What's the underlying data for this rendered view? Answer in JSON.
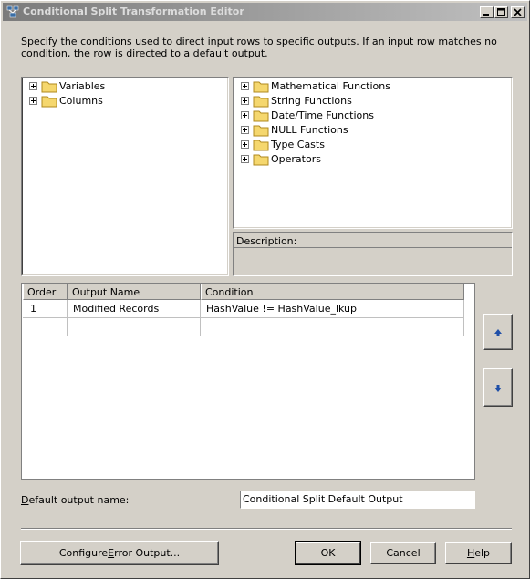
{
  "window": {
    "title": "Conditional Split Transformation Editor"
  },
  "description": "Specify the conditions used to direct input rows to specific outputs. If an input row matches no condition, the row is directed to a default output.",
  "left_tree": [
    {
      "label": "Variables",
      "icon": "folder-icon"
    },
    {
      "label": "Columns",
      "icon": "folder-icon"
    }
  ],
  "right_tree": [
    {
      "label": "Mathematical Functions",
      "icon": "folder-icon"
    },
    {
      "label": "String Functions",
      "icon": "folder-icon"
    },
    {
      "label": "Date/Time Functions",
      "icon": "folder-icon"
    },
    {
      "label": "NULL Functions",
      "icon": "folder-icon"
    },
    {
      "label": "Type Casts",
      "icon": "folder-icon"
    },
    {
      "label": "Operators",
      "icon": "folder-icon"
    }
  ],
  "description_panel": {
    "label": "Description:"
  },
  "grid": {
    "columns": [
      "Order",
      "Output Name",
      "Condition"
    ],
    "rows": [
      {
        "order": "1",
        "output_name": "Modified Records",
        "condition": "HashValue != HashValue_lkup"
      }
    ]
  },
  "default_output": {
    "label_pre": "D",
    "label_rest": "efault output name:",
    "value": "Conditional Split Default Output"
  },
  "buttons": {
    "configure_error_pre": "Configure ",
    "configure_error_ul": "E",
    "configure_error_post": "rror Output...",
    "ok": "OK",
    "cancel": "Cancel",
    "help_ul": "H",
    "help_rest": "elp"
  },
  "colors": {
    "title_gradient_start": "#7b7b7b",
    "title_gradient_end": "#c0c0c0",
    "window_bg": "#d4d0c8",
    "folder": "#f5d76e"
  }
}
